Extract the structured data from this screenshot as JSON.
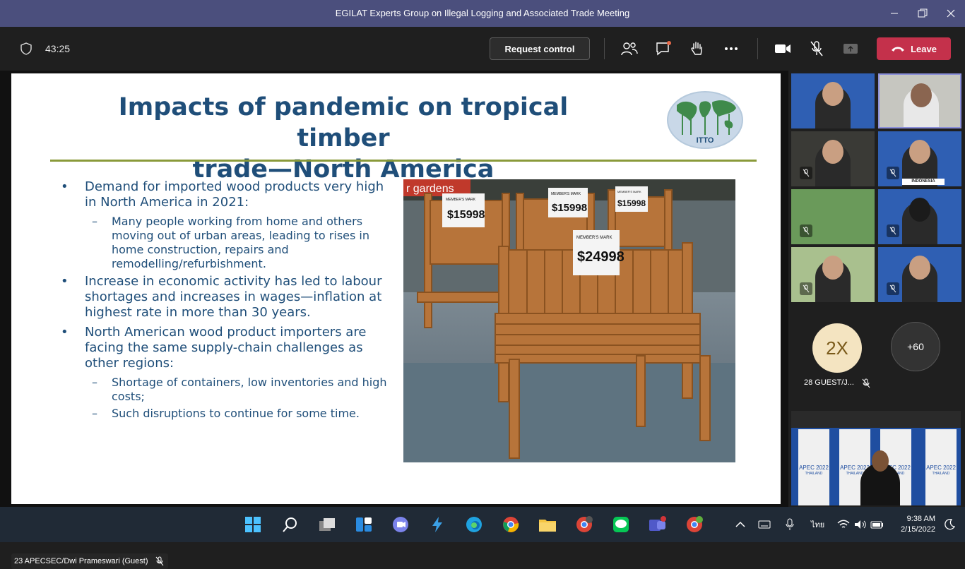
{
  "window": {
    "title": "EGILAT Experts Group on Illegal Logging and Associated Trade Meeting"
  },
  "toolbar": {
    "timer": "43:25",
    "request_control_label": "Request control",
    "leave_label": "Leave"
  },
  "slide": {
    "title_line1": "Impacts of pandemic on tropical timber",
    "title_line2": "trade—North America",
    "logo_text": "ITTO",
    "bullets": [
      {
        "text": "Demand for imported wood products very high in North America in 2021:",
        "sub": [
          "Many people working from home and others moving out of urban areas, leading to rises in home construction, repairs and remodelling/refurbishment."
        ]
      },
      {
        "text": "Increase in economic activity has led to labour shortages and increases in wages—inflation at highest rate in more than 30 years.",
        "sub": []
      },
      {
        "text": "North American wood product importers are facing the same supply-chain challenges as other regions:",
        "sub": [
          "Shortage of containers, low inventories and high costs;",
          "Such disruptions to continue for some time."
        ]
      }
    ],
    "photo": {
      "sign": "r gardens",
      "tag_labels": [
        "MEMBER'S MARK",
        "MEMBER'S MARK",
        "MEMBER'S MARK",
        "MEMBER'S MARK"
      ],
      "prices": [
        "$15998",
        "$15998",
        "$15998",
        "$24998"
      ]
    }
  },
  "stage": {
    "presenter_label": "23 APECSEC/Dwi Prameswari (Guest)"
  },
  "side": {
    "tile_caption": "INDONESIA",
    "avatar_initials": "2X",
    "more_count": "+60",
    "guest_name": "28 GUEST/J...",
    "banner_text": [
      "APEC 2022",
      "APEC 2022",
      "APEC 2022",
      "APEC 2022"
    ],
    "banner_subtext": [
      "THAILAND",
      "THAILAND",
      "THAILAND",
      "THAILAND"
    ]
  },
  "taskbar": {
    "time": "9:38 AM",
    "date": "2/15/2022",
    "lang": "ไทย"
  },
  "colors": {
    "titlebar": "#4b4f7d",
    "leave": "#c4314b",
    "slide_title": "#1f4e79",
    "rule": "#8a9a3a",
    "tile_bg": "#2f5fb3"
  }
}
